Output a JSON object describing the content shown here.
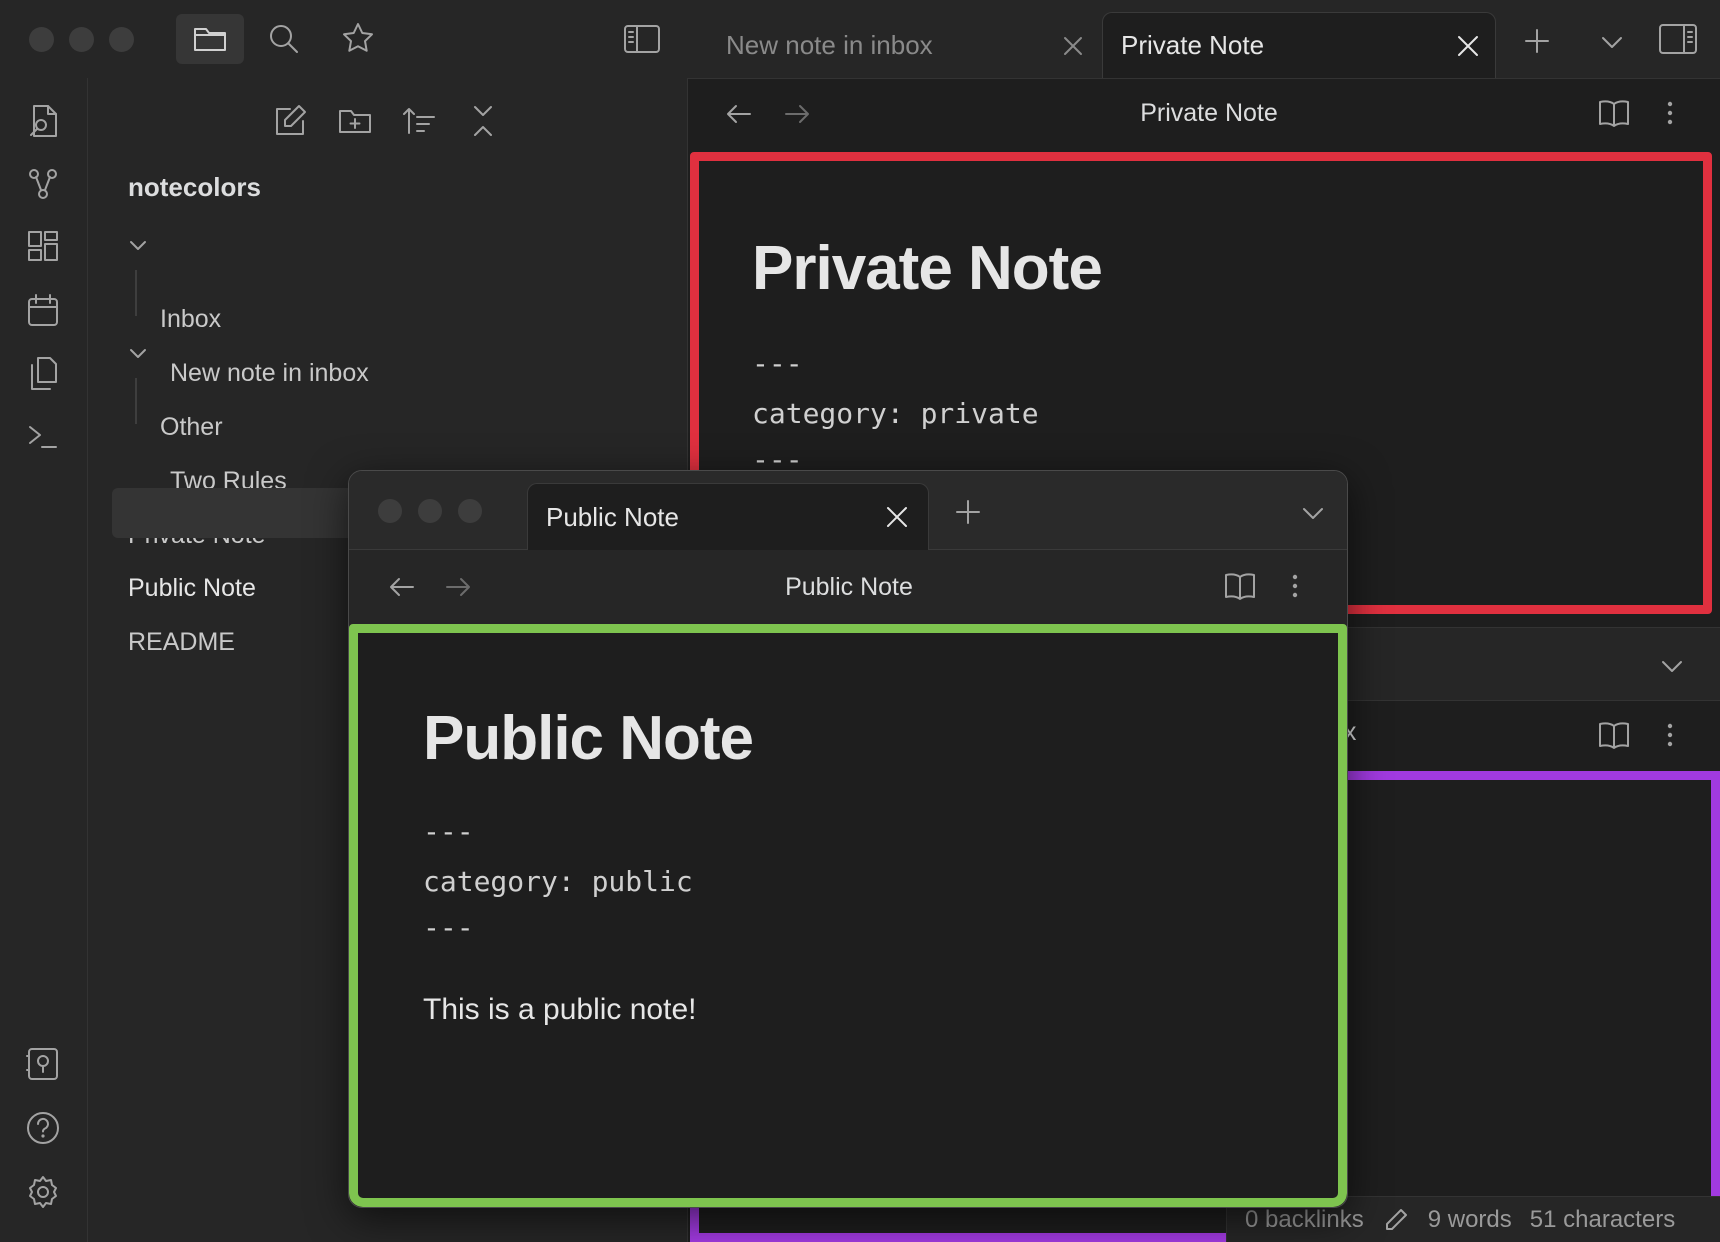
{
  "colors": {
    "private_border": "#e0303f",
    "public_border": "#7ec44f",
    "inbox_border": "#a13ae0"
  },
  "sidebar": {
    "vault_name": "notecolors",
    "items": [
      {
        "label": "Inbox",
        "type": "folder"
      },
      {
        "label": "New note in inbox",
        "type": "file"
      },
      {
        "label": "Other",
        "type": "folder"
      },
      {
        "label": "Two Rules",
        "type": "file"
      },
      {
        "label": "Private Note",
        "type": "file"
      },
      {
        "label": "Public Note",
        "type": "file",
        "selected": true
      },
      {
        "label": "README",
        "type": "file"
      }
    ]
  },
  "tabs": [
    {
      "label": "New note in inbox",
      "active": false
    },
    {
      "label": "Private Note",
      "active": true
    }
  ],
  "main": {
    "header_title": "Private Note",
    "note_title": "Private Note",
    "frontmatter_open": "---",
    "frontmatter_line": "category: private",
    "frontmatter_close": "---"
  },
  "lower_pane": {
    "header_title_fragment": "ox"
  },
  "popout": {
    "tab_label": "Public Note",
    "header_title": "Public Note",
    "note_title": "Public Note",
    "frontmatter_open": "---",
    "frontmatter_line": "category: public",
    "frontmatter_close": "---",
    "body": "This is a public note!"
  },
  "status": {
    "backlinks": "0 backlinks",
    "words": "9 words",
    "characters": "51 characters"
  }
}
